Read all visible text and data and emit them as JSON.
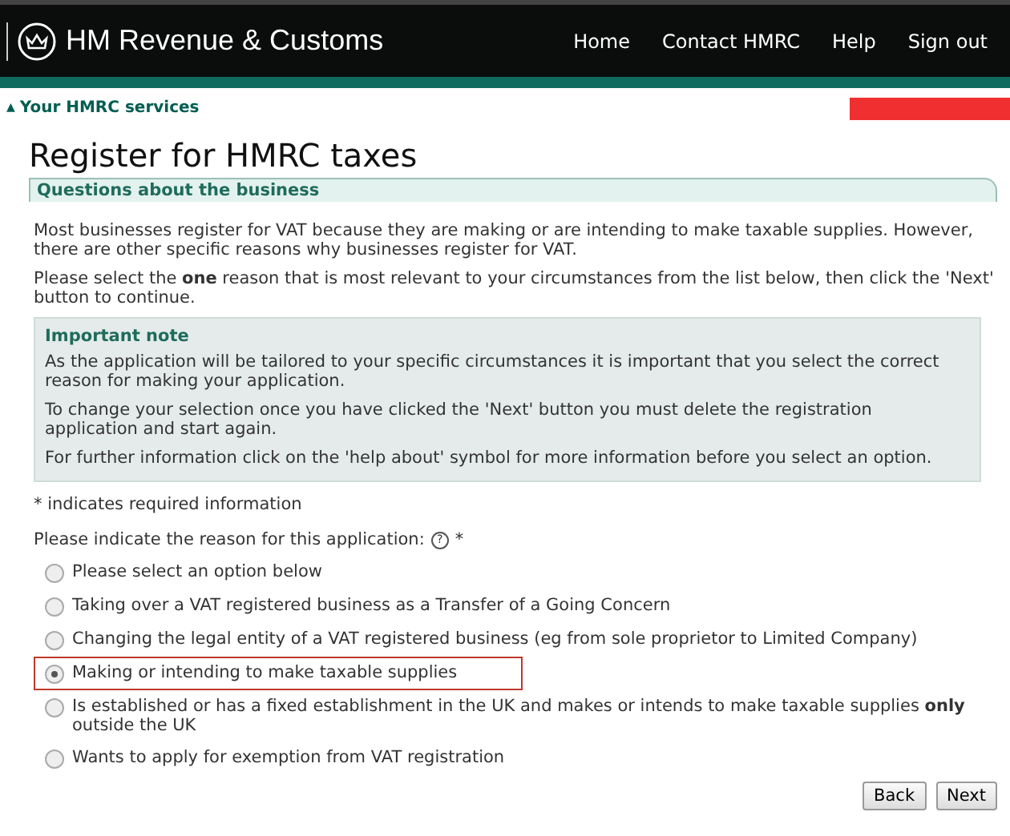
{
  "header": {
    "brand": "HM Revenue & Customs",
    "nav": [
      "Home",
      "Contact HMRC",
      "Help",
      "Sign out"
    ]
  },
  "breadcrumb": {
    "icon": "▲",
    "label": "Your HMRC services"
  },
  "page_title": "Register for HMRC taxes",
  "section_heading": "Questions about the business",
  "intro": [
    "Most businesses register for VAT because they are making or are intending to make taxable supplies. However, there are other specific reasons why businesses register for VAT.",
    "Please select the **one** reason that is most relevant to your circumstances from the list below, then click the 'Next' button to continue."
  ],
  "note": {
    "title": "Important note",
    "paragraphs": [
      "As the application will be tailored to your specific circumstances it is important that you select the correct reason for making your application.",
      "To change your selection once you have clicked the 'Next' button you must delete the registration application and start again.",
      "For further information click on the 'help about' symbol for more information before you select an option."
    ]
  },
  "required_hint": "* indicates required information",
  "question": {
    "label": "Please indicate the reason for this application:",
    "help": "?",
    "required": "*"
  },
  "options": [
    {
      "label": "Please select an option below",
      "selected": false
    },
    {
      "label": "Taking over a VAT registered business as a Transfer of a Going Concern",
      "selected": false
    },
    {
      "label": "Changing the legal entity of a VAT registered business (eg from sole proprietor to Limited Company)",
      "selected": false
    },
    {
      "label": "Making or intending to make taxable supplies",
      "selected": true
    },
    {
      "label": "Is established or has a fixed establishment in the UK and makes or intends to make taxable supplies **only** outside the UK",
      "selected": false
    },
    {
      "label": "Wants to apply for exemption from VAT registration",
      "selected": false
    }
  ],
  "buttons": [
    "Back",
    "Next"
  ]
}
